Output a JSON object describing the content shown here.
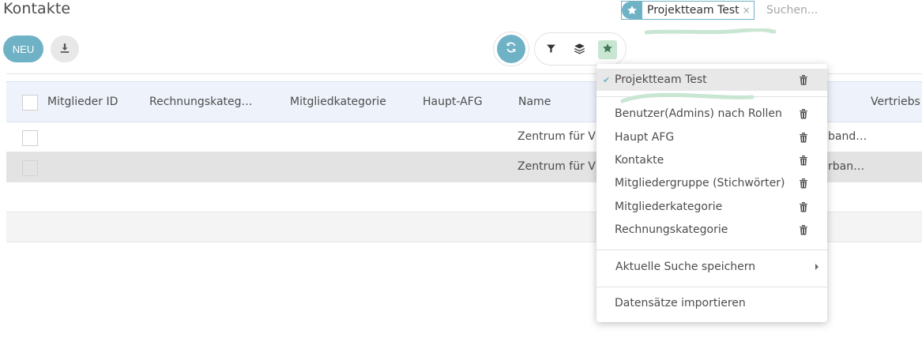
{
  "page": {
    "title": "Kontakte"
  },
  "toolbar": {
    "new_label": "NEU",
    "download_icon": "download-icon",
    "refresh_icon": "refresh-icon",
    "filter_icon": "filter-icon",
    "groupby_icon": "layers-icon",
    "favorites_icon": "star-icon"
  },
  "search": {
    "facet_label": "Projektteam Test",
    "facet_close": "×",
    "placeholder": "Suchen..."
  },
  "table": {
    "columns": [
      "Mitglieder ID",
      "Rechnungskateg…",
      "Mitgliedkategorie",
      "Haupt-AFG",
      "Name",
      "Vertriebs"
    ],
    "rows": [
      {
        "name": "Zentrum für V",
        "trailing": "band…"
      },
      {
        "name": "Zentrum für V",
        "trailing": "rban…"
      }
    ]
  },
  "favorites_menu": {
    "active_item": "Projektteam Test",
    "check": "✔",
    "items": [
      "Benutzer(Admins) nach Rollen",
      "Haupt AFG",
      "Kontakte",
      "Mitgliedergruppe (Stichwörter)",
      "Mitgliederkategorie",
      "Rechnungskategorie"
    ],
    "save_search": "Aktuelle Suche speichern",
    "import_records": "Datensätze importieren"
  },
  "colors": {
    "accent": "#6fb2c6",
    "highlight": "#c9e6d3",
    "header_bg": "#eef3fb",
    "selected_row": "#e3e3e3"
  }
}
